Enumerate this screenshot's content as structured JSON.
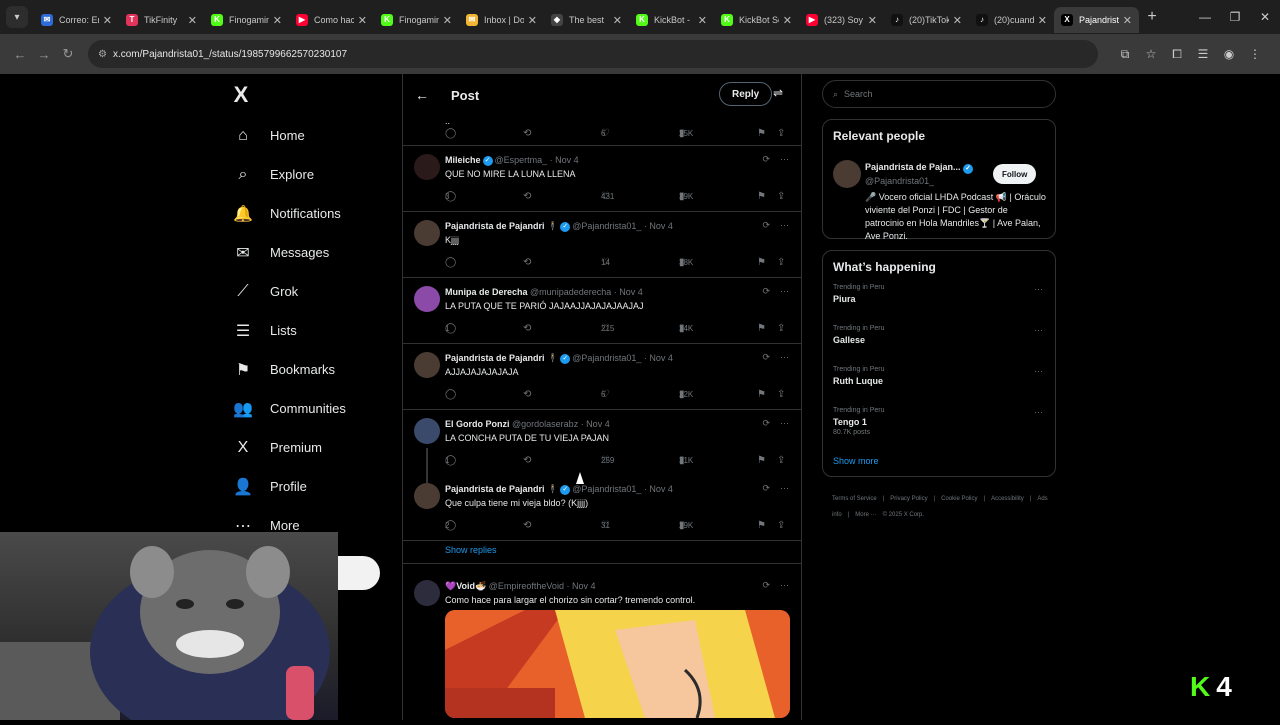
{
  "browser": {
    "tabs": [
      {
        "label": "Correo: Er",
        "fav": "#2e6ad8",
        "ch": "✉"
      },
      {
        "label": "TikFinity",
        "fav": "#e2345a",
        "ch": "T"
      },
      {
        "label": "Finogamin",
        "fav": "#53fc18",
        "ch": "K"
      },
      {
        "label": "Como hac",
        "fav": "#ff0033",
        "ch": "▶"
      },
      {
        "label": "Finogamin",
        "fav": "#53fc18",
        "ch": "K"
      },
      {
        "label": "Inbox | Do",
        "fav": "#f2b632",
        "ch": "✉"
      },
      {
        "label": "The best",
        "fav": "#444",
        "ch": "◆"
      },
      {
        "label": "KickBot -",
        "fav": "#53fc18",
        "ch": "K"
      },
      {
        "label": "KickBot Se",
        "fav": "#53fc18",
        "ch": "K"
      },
      {
        "label": "(323) Soy",
        "fav": "#ff0033",
        "ch": "▶"
      },
      {
        "label": "(20)TikTok",
        "fav": "#111",
        "ch": "♪"
      },
      {
        "label": "(20)cuand",
        "fav": "#111",
        "ch": "♪"
      },
      {
        "label": "Pajandrista",
        "fav": "#000",
        "ch": "X"
      }
    ],
    "url": "x.com/Pajandrista01_/status/1985799662570230107"
  },
  "nav": {
    "logo": "X",
    "items": [
      {
        "label": "Home",
        "icon": "⌂",
        "name": "home"
      },
      {
        "label": "Explore",
        "icon": "⌕",
        "name": "explore"
      },
      {
        "label": "Notifications",
        "icon": "🔔",
        "name": "notifications"
      },
      {
        "label": "Messages",
        "icon": "✉",
        "name": "messages"
      },
      {
        "label": "Grok",
        "icon": "⟋",
        "name": "grok"
      },
      {
        "label": "Lists",
        "icon": "☰",
        "name": "lists"
      },
      {
        "label": "Bookmarks",
        "icon": "⚑",
        "name": "bookmarks"
      },
      {
        "label": "Communities",
        "icon": "👥",
        "name": "communities"
      },
      {
        "label": "Premium",
        "icon": "X",
        "name": "premium"
      },
      {
        "label": "Profile",
        "icon": "👤",
        "name": "profile"
      },
      {
        "label": "More",
        "icon": "⋯",
        "name": "more"
      }
    ]
  },
  "main": {
    "title": "Post",
    "reply_label": "Reply",
    "top_actions": {
      "replies": "",
      "likes": "6",
      "views": "25K"
    },
    "tweets": [
      {
        "name": "Mileiche",
        "verified": true,
        "handle": "@Espertma_ · Nov 4",
        "text": "QUE NO MIRE LA LUNA LLENA",
        "replies": "3",
        "likes": "431",
        "views": "39K",
        "avatar": "#2a1a1a",
        "chain": false
      },
      {
        "name": "Pajandrista de Pajandri 🕴",
        "verified": true,
        "handle": "@Pajandrista01_ · Nov 4",
        "text": "Kjjjj",
        "replies": "",
        "likes": "14",
        "views": "38K",
        "avatar": "#4a3c32",
        "chain": false
      },
      {
        "name": "Munipa de Derecha",
        "verified": false,
        "handle": "@munipadederecha · Nov 4",
        "text": "LA PUTA QUE TE PARIÓ JAJAAJJAJAJAJAAJAJ",
        "replies": "1",
        "likes": "215",
        "views": "24K",
        "avatar": "#8b4aa8",
        "chain": false
      },
      {
        "name": "Pajandrista de Pajandri 🕴",
        "verified": true,
        "handle": "@Pajandrista01_ · Nov 4",
        "text": "AJJAJAJAJAJAJA",
        "replies": "",
        "likes": "6",
        "views": "22K",
        "avatar": "#4a3c32",
        "chain": false
      },
      {
        "name": "El Gordo Ponzi",
        "verified": false,
        "handle": "@gordolaserabz · Nov 4",
        "text": "LA CONCHA PUTA DE TU VIEJA PAJAN",
        "replies": "1",
        "likes": "259",
        "views": "31K",
        "avatar": "#3a4a6a",
        "chain": true
      },
      {
        "name": "Pajandrista de Pajandri 🕴",
        "verified": true,
        "handle": "@Pajandrista01_ · Nov 4",
        "text": "Que culpa tiene mi vieja bldo? (Kjjjj)",
        "replies": "2",
        "likes": "31",
        "views": "29K",
        "avatar": "#4a3c32",
        "chain": false
      }
    ],
    "show_replies": "Show replies",
    "last_tweet": {
      "name": "💜Void🍜",
      "handle": "@EmpireoftheVoid · Nov 4",
      "text": "Como hace para largar el chorizo sin cortar? tremendo control."
    }
  },
  "right": {
    "search_placeholder": "Search",
    "relevant_title": "Relevant people",
    "person": {
      "name": "Pajandrista de Pajan...",
      "handle": "@Pajandrista01_",
      "follow": "Follow",
      "bio": "🎤 Vocero oficial LHDA Podcast 📢 | Oráculo viviente del Ponzi | FDC | Gestor de patrocinio en Hola Mandriles🍸 | Ave Palan, Ave Ponzi."
    },
    "happening_title": "What’s happening",
    "trends": [
      {
        "ctx": "Trending in Peru",
        "title": "Piura",
        "count": ""
      },
      {
        "ctx": "Trending in Peru",
        "title": "Gallese",
        "count": ""
      },
      {
        "ctx": "Trending in Peru",
        "title": "Ruth Luque",
        "count": ""
      },
      {
        "ctx": "Trending in Peru",
        "title": "Tengo 1",
        "count": "80.7K posts"
      }
    ],
    "show_more": "Show more",
    "footer": [
      "Terms of Service",
      "|",
      "Privacy Policy",
      "|",
      "Cookie Policy",
      "|",
      "Accessibility",
      "|",
      "Ads info",
      "|",
      "More ···",
      "© 2025 X Corp."
    ]
  },
  "overlay": {
    "kick_letter": "K",
    "kick_count": "4"
  }
}
